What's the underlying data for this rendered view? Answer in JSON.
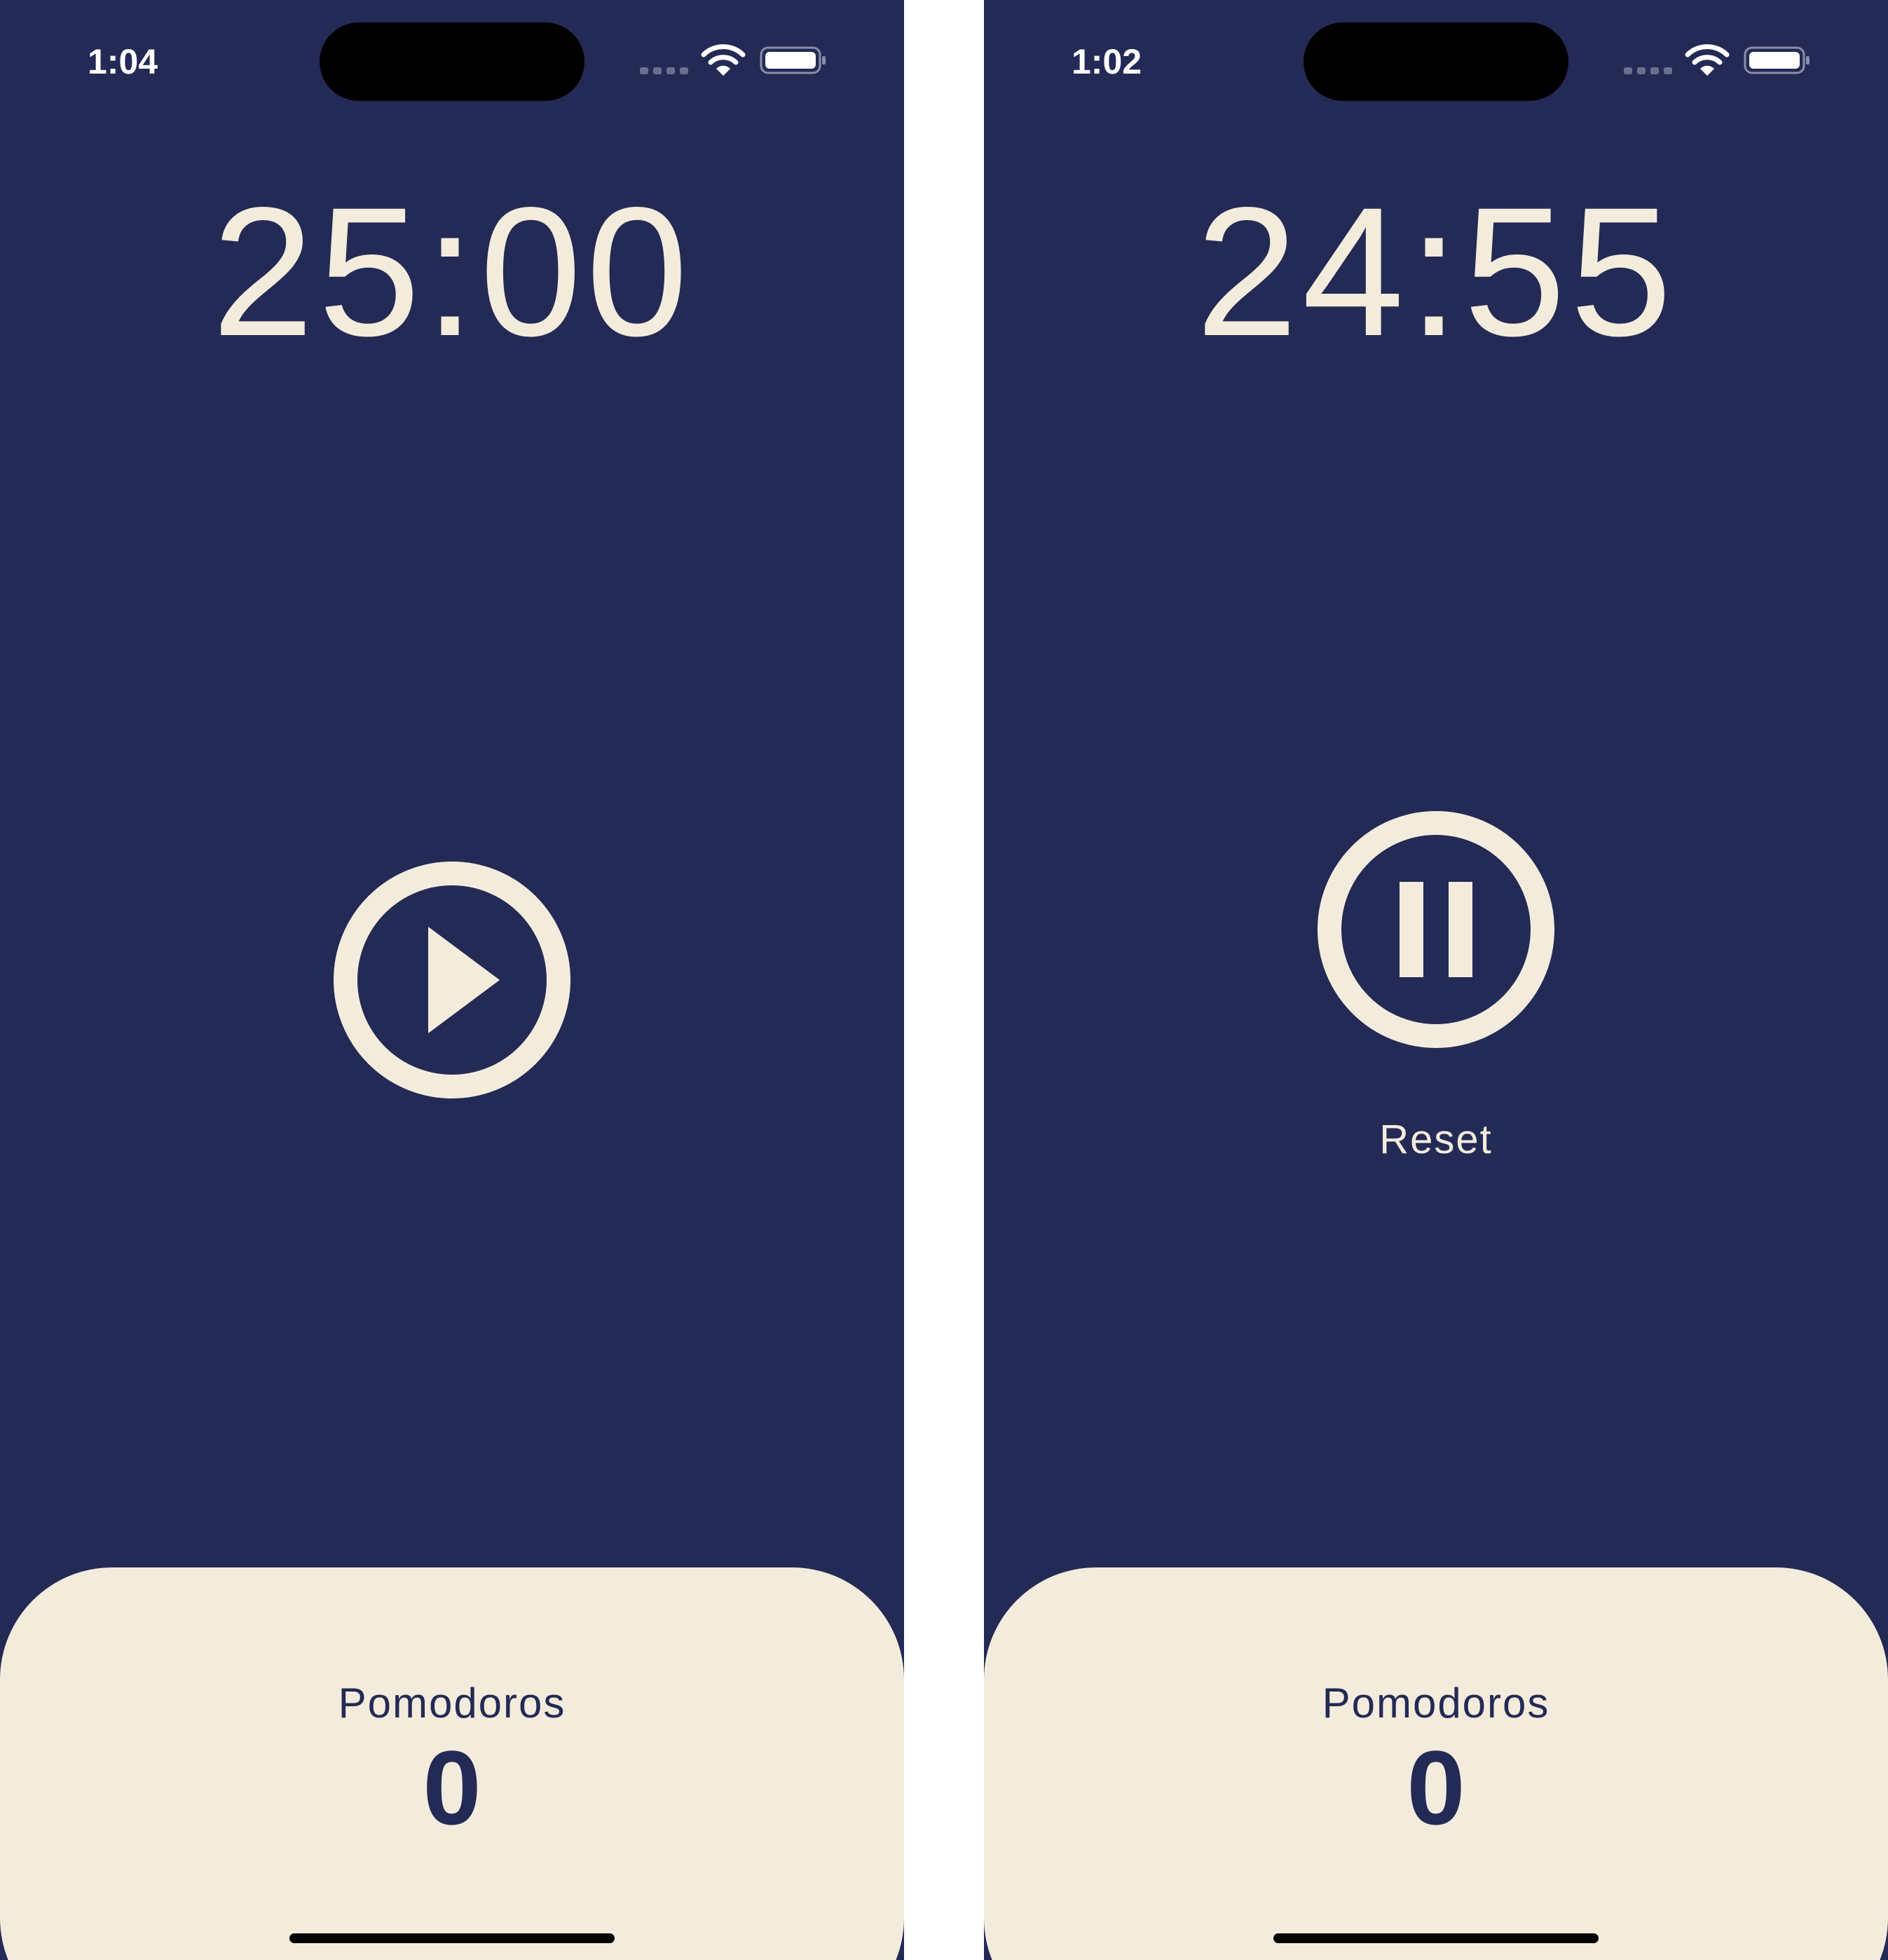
{
  "colors": {
    "background": "#232a55",
    "accent": "#f3ecdc",
    "panel": "#f3ecdc",
    "panel_text": "#232a55"
  },
  "screens": [
    {
      "status_bar": {
        "time": "1:04",
        "icons": [
          "signal-icon",
          "wifi-icon",
          "battery-icon"
        ]
      },
      "timer": "25:00",
      "control": {
        "icon": "play-icon"
      },
      "panel": {
        "label": "Pomodoros",
        "count": "0"
      }
    },
    {
      "status_bar": {
        "time": "1:02",
        "icons": [
          "signal-icon",
          "wifi-icon",
          "battery-icon"
        ]
      },
      "timer": "24:55",
      "control": {
        "icon": "pause-icon"
      },
      "reset_label": "Reset",
      "panel": {
        "label": "Pomodoros",
        "count": "0"
      }
    }
  ]
}
